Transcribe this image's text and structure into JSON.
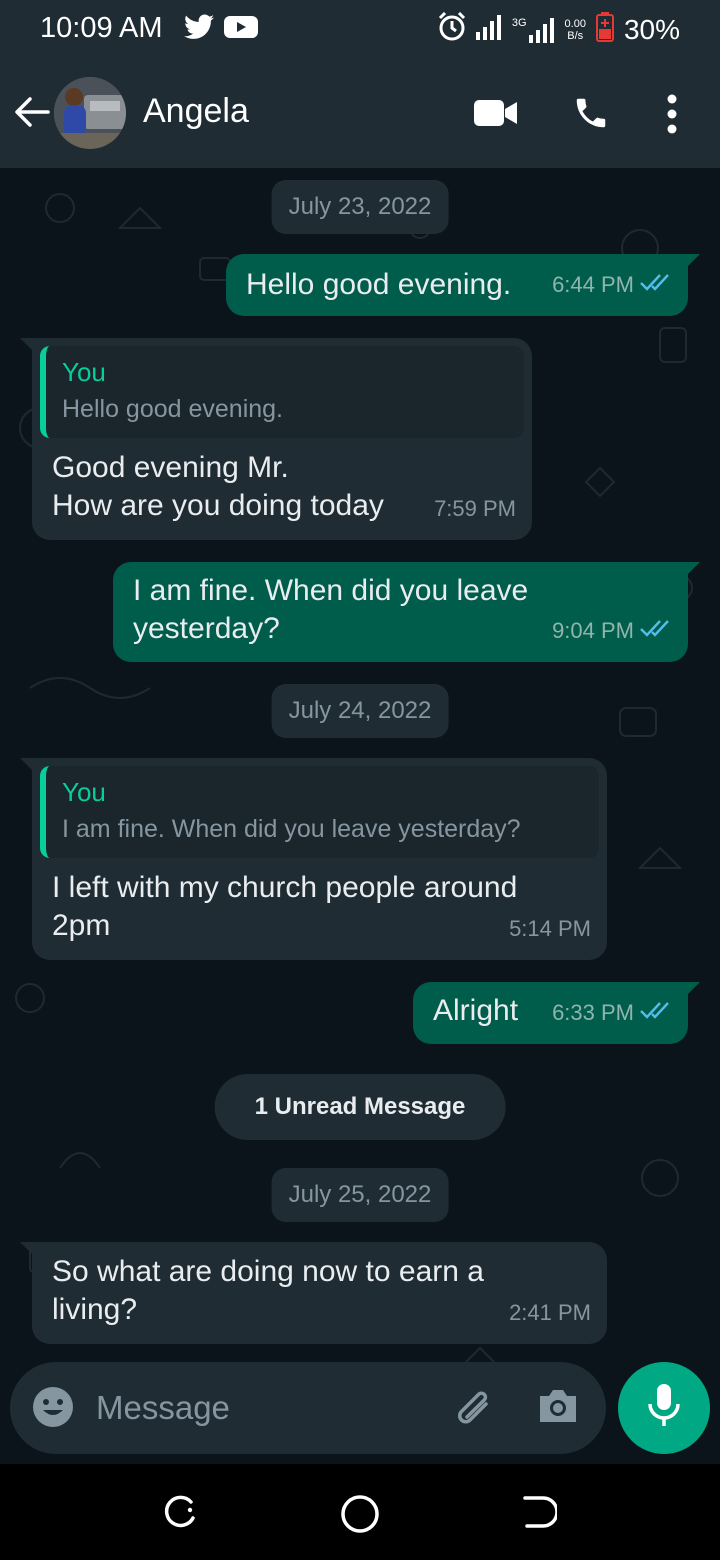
{
  "status_bar": {
    "time": "10:09 AM",
    "network_speed_value": "0.00",
    "network_speed_unit": "B/s",
    "network_type": "3G",
    "battery": "30%",
    "icons": [
      "twitter-icon",
      "youtube-icon",
      "alarm-icon",
      "signal-icon",
      "signal-3g-icon",
      "battery-icon"
    ]
  },
  "header": {
    "contact_name": "Angela",
    "icons": [
      "back-arrow-icon",
      "video-call-icon",
      "voice-call-icon",
      "more-options-icon"
    ]
  },
  "conversation": {
    "date_1": "July 23, 2022",
    "msg_1": {
      "text": "Hello good evening.",
      "time": "6:44 PM",
      "direction": "outgoing",
      "status": "read"
    },
    "msg_2": {
      "quote_author": "You",
      "quote_text": "Hello good evening.",
      "line1": "Good evening Mr.",
      "line2": "How are you doing today",
      "time": "7:59 PM",
      "direction": "incoming"
    },
    "msg_3": {
      "line1": "I am fine. When did you leave",
      "line2": "yesterday?",
      "time": "9:04 PM",
      "direction": "outgoing",
      "status": "read"
    },
    "date_2": "July 24, 2022",
    "msg_4": {
      "quote_author": "You",
      "quote_text": "I am fine. When did you leave yesterday?",
      "line1": "I left with my church people around",
      "line2": "2pm",
      "time": "5:14 PM",
      "direction": "incoming"
    },
    "msg_5": {
      "text": "Alright",
      "time": "6:33 PM",
      "direction": "outgoing",
      "status": "read"
    },
    "unread_banner": "1 Unread Message",
    "date_3": "July 25, 2022",
    "msg_6": {
      "line1": "So what are doing now to earn a",
      "line2": "living?",
      "time": "2:41 PM",
      "direction": "incoming"
    }
  },
  "composer": {
    "placeholder": "Message",
    "icons": [
      "emoji-icon",
      "attach-icon",
      "camera-icon",
      "mic-icon"
    ]
  },
  "colors": {
    "outgoing_bubble": "#005c4b",
    "incoming_bubble": "#202c33",
    "accent": "#00a884",
    "quote_accent": "#06cf9c",
    "read_ticks": "#53bdeb",
    "background": "#0b141a"
  }
}
